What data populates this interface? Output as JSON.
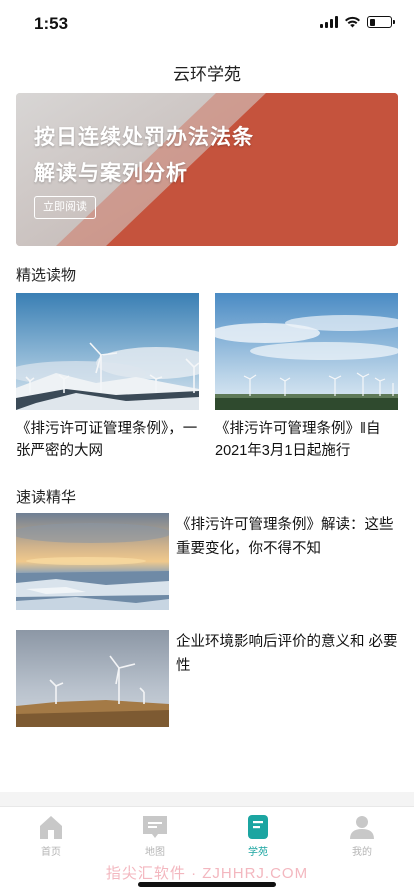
{
  "status": {
    "time": "1:53"
  },
  "header": {
    "title": "云环学苑"
  },
  "banner": {
    "line1": "按日连续处罚办法法条",
    "line2": "解读与案列分析",
    "button": "立即阅读"
  },
  "featured": {
    "title": "精选读物",
    "items": [
      {
        "text": "《排污许可证管理条例》，一张严密的大网"
      },
      {
        "text": "《排污许可管理条例》‖自2021年3月1日起施行"
      }
    ]
  },
  "quick": {
    "title": "速读精华",
    "items": [
      {
        "text": "《排污许可管理条例》解读：这些重要变化，你不得不知"
      },
      {
        "text": "企业环境影响后评价的意义和 必要性"
      }
    ]
  },
  "tabs": [
    {
      "label": "首页",
      "icon": "home-icon"
    },
    {
      "label": "地图",
      "icon": "map-icon"
    },
    {
      "label": "学苑",
      "icon": "book-icon"
    },
    {
      "label": "我的",
      "icon": "user-icon"
    }
  ],
  "watermark": "指尖汇软件 · ZJHHRJ.COM",
  "colors": {
    "accent": "#1ba5a1",
    "inactive": "#b5b5b5",
    "banner_red": "#c24a35"
  }
}
